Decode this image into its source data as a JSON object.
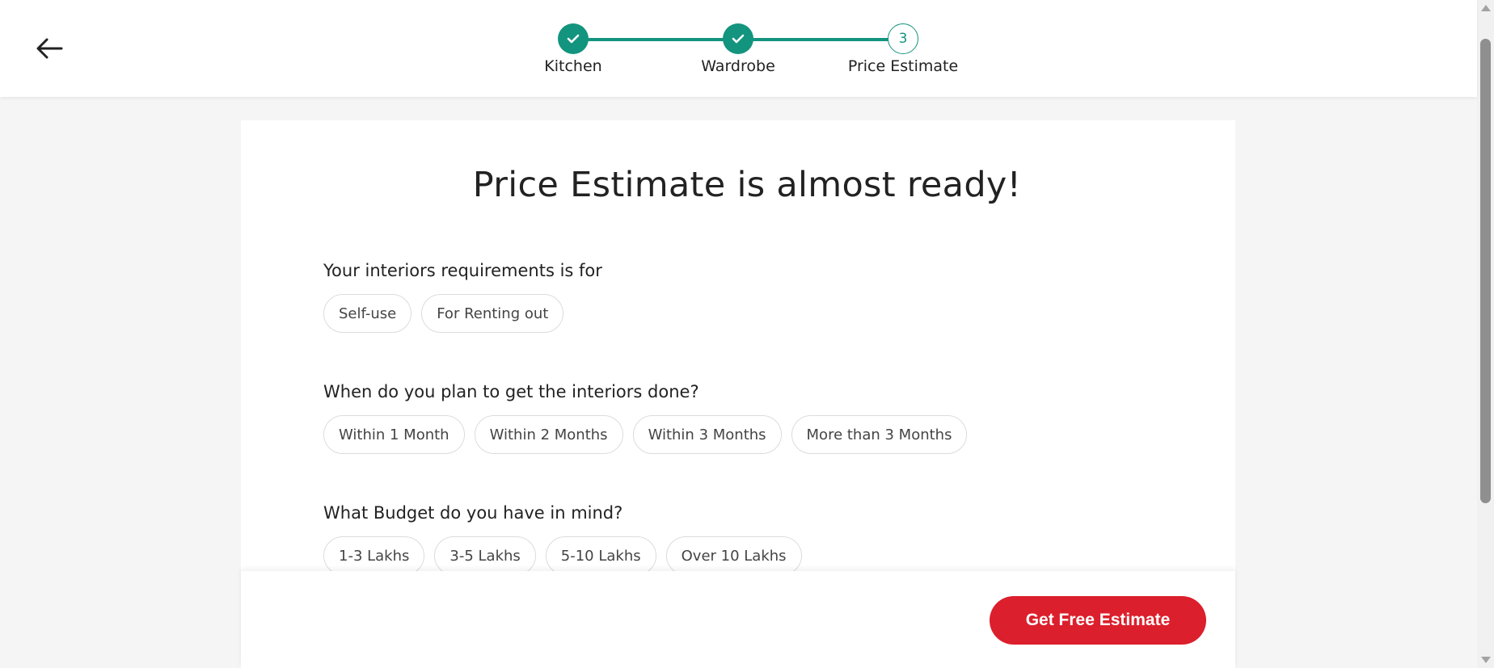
{
  "header": {
    "back_icon": "arrow-left-icon",
    "steps": [
      {
        "label": "Kitchen",
        "status": "done",
        "icon": "check-icon"
      },
      {
        "label": "Wardrobe",
        "status": "done",
        "icon": "check-icon"
      },
      {
        "label": "Price Estimate",
        "status": "current",
        "number": "3"
      }
    ],
    "accent_color": "#13947e"
  },
  "main": {
    "title": "Price Estimate is almost ready!",
    "questions": [
      {
        "title": "Your interiors requirements is for",
        "options": [
          "Self-use",
          "For Renting out"
        ]
      },
      {
        "title": "When do you plan to get the interiors done?",
        "options": [
          "Within 1 Month",
          "Within 2 Months",
          "Within 3 Months",
          "More than 3 Months"
        ]
      },
      {
        "title": "What Budget do you have in mind?",
        "options": [
          "1-3 Lakhs",
          "3-5 Lakhs",
          "5-10 Lakhs",
          "Over 10 Lakhs"
        ]
      }
    ]
  },
  "footer": {
    "cta_label": "Get Free Estimate",
    "cta_color": "#dc1f2c"
  }
}
